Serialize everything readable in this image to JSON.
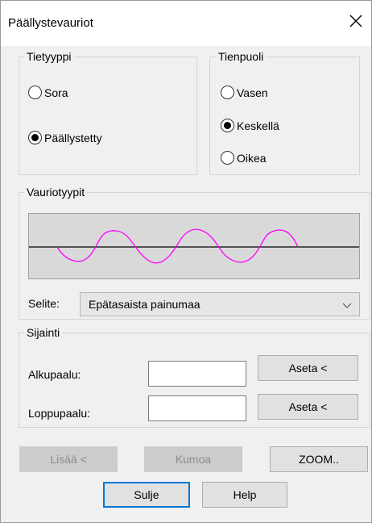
{
  "window": {
    "title": "Päällystevauriot"
  },
  "tietyyppi": {
    "label": "Tietyyppi",
    "options": [
      "Sora",
      "Päällystetty"
    ],
    "selected": "Päällystetty"
  },
  "tienpuoli": {
    "label": "Tienpuoli",
    "options": [
      "Vasen",
      "Keskellä",
      "Oikea"
    ],
    "selected": "Keskellä"
  },
  "vauriotyypit": {
    "label": "Vauriotyypit",
    "selite_label": "Selite:",
    "selite_value": "Epätasaista painumaa",
    "wave_color": "#ff00ff"
  },
  "sijainti": {
    "label": "Sijainti",
    "alkupaalu_label": "Alkupaalu:",
    "alkupaalu_value": "",
    "loppupaalu_label": "Loppupaalu:",
    "loppupaalu_value": "",
    "aseta_label": "Aseta <"
  },
  "buttons": {
    "lisaa": "Lisää <",
    "kumoa": "Kumoa",
    "zoom": "ZOOM..",
    "sulje": "Sulje",
    "help": "Help"
  }
}
